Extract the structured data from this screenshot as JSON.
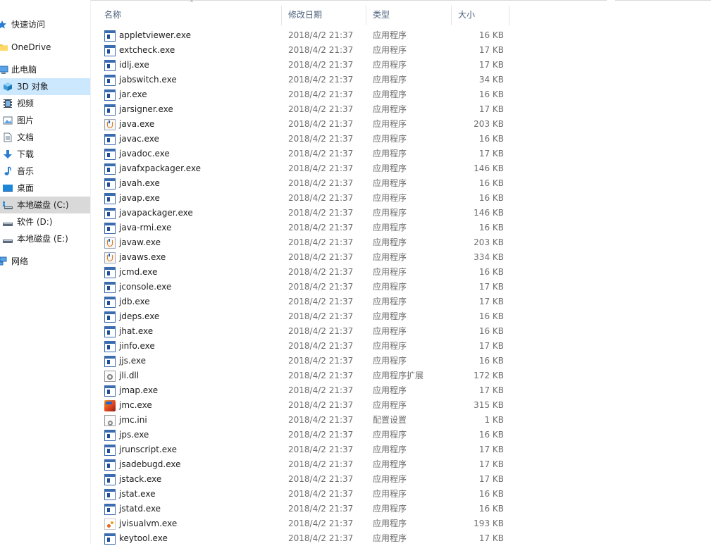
{
  "sidebar": {
    "items": [
      {
        "label": "快速访问",
        "icon": "star-icon"
      },
      {
        "label": "OneDrive",
        "icon": "folder-icon"
      },
      {
        "label": "此电脑",
        "icon": "computer-icon"
      },
      {
        "label": "3D 对象",
        "icon": "cube-3d-icon"
      },
      {
        "label": "视频",
        "icon": "video-icon"
      },
      {
        "label": "图片",
        "icon": "picture-icon"
      },
      {
        "label": "文档",
        "icon": "document-icon"
      },
      {
        "label": "下载",
        "icon": "download-arrow-icon"
      },
      {
        "label": "音乐",
        "icon": "music-note-icon"
      },
      {
        "label": "桌面",
        "icon": "desktop-icon"
      },
      {
        "label": "本地磁盘 (C:)",
        "icon": "system-drive-icon"
      },
      {
        "label": "软件 (D:)",
        "icon": "drive-icon"
      },
      {
        "label": "本地磁盘 (E:)",
        "icon": "drive-icon"
      },
      {
        "label": "网络",
        "icon": "network-icon"
      }
    ]
  },
  "columns": {
    "name": "名称",
    "date": "修改日期",
    "type": "类型",
    "size": "大小"
  },
  "files": [
    {
      "name": "appletviewer.exe",
      "date": "2018/4/2 21:37",
      "type": "应用程序",
      "size": "16 KB",
      "icon": "exe"
    },
    {
      "name": "extcheck.exe",
      "date": "2018/4/2 21:37",
      "type": "应用程序",
      "size": "17 KB",
      "icon": "exe"
    },
    {
      "name": "idlj.exe",
      "date": "2018/4/2 21:37",
      "type": "应用程序",
      "size": "17 KB",
      "icon": "exe"
    },
    {
      "name": "jabswitch.exe",
      "date": "2018/4/2 21:37",
      "type": "应用程序",
      "size": "34 KB",
      "icon": "exe"
    },
    {
      "name": "jar.exe",
      "date": "2018/4/2 21:37",
      "type": "应用程序",
      "size": "16 KB",
      "icon": "exe"
    },
    {
      "name": "jarsigner.exe",
      "date": "2018/4/2 21:37",
      "type": "应用程序",
      "size": "17 KB",
      "icon": "exe"
    },
    {
      "name": "java.exe",
      "date": "2018/4/2 21:37",
      "type": "应用程序",
      "size": "203 KB",
      "icon": "java"
    },
    {
      "name": "javac.exe",
      "date": "2018/4/2 21:37",
      "type": "应用程序",
      "size": "16 KB",
      "icon": "exe"
    },
    {
      "name": "javadoc.exe",
      "date": "2018/4/2 21:37",
      "type": "应用程序",
      "size": "17 KB",
      "icon": "exe"
    },
    {
      "name": "javafxpackager.exe",
      "date": "2018/4/2 21:37",
      "type": "应用程序",
      "size": "146 KB",
      "icon": "exe"
    },
    {
      "name": "javah.exe",
      "date": "2018/4/2 21:37",
      "type": "应用程序",
      "size": "16 KB",
      "icon": "exe"
    },
    {
      "name": "javap.exe",
      "date": "2018/4/2 21:37",
      "type": "应用程序",
      "size": "16 KB",
      "icon": "exe"
    },
    {
      "name": "javapackager.exe",
      "date": "2018/4/2 21:37",
      "type": "应用程序",
      "size": "146 KB",
      "icon": "exe"
    },
    {
      "name": "java-rmi.exe",
      "date": "2018/4/2 21:37",
      "type": "应用程序",
      "size": "16 KB",
      "icon": "exe"
    },
    {
      "name": "javaw.exe",
      "date": "2018/4/2 21:37",
      "type": "应用程序",
      "size": "203 KB",
      "icon": "java"
    },
    {
      "name": "javaws.exe",
      "date": "2018/4/2 21:37",
      "type": "应用程序",
      "size": "334 KB",
      "icon": "java"
    },
    {
      "name": "jcmd.exe",
      "date": "2018/4/2 21:37",
      "type": "应用程序",
      "size": "16 KB",
      "icon": "exe"
    },
    {
      "name": "jconsole.exe",
      "date": "2018/4/2 21:37",
      "type": "应用程序",
      "size": "17 KB",
      "icon": "exe"
    },
    {
      "name": "jdb.exe",
      "date": "2018/4/2 21:37",
      "type": "应用程序",
      "size": "17 KB",
      "icon": "exe"
    },
    {
      "name": "jdeps.exe",
      "date": "2018/4/2 21:37",
      "type": "应用程序",
      "size": "16 KB",
      "icon": "exe"
    },
    {
      "name": "jhat.exe",
      "date": "2018/4/2 21:37",
      "type": "应用程序",
      "size": "16 KB",
      "icon": "exe"
    },
    {
      "name": "jinfo.exe",
      "date": "2018/4/2 21:37",
      "type": "应用程序",
      "size": "17 KB",
      "icon": "exe"
    },
    {
      "name": "jjs.exe",
      "date": "2018/4/2 21:37",
      "type": "应用程序",
      "size": "16 KB",
      "icon": "exe"
    },
    {
      "name": "jli.dll",
      "date": "2018/4/2 21:37",
      "type": "应用程序扩展",
      "size": "172 KB",
      "icon": "dll"
    },
    {
      "name": "jmap.exe",
      "date": "2018/4/2 21:37",
      "type": "应用程序",
      "size": "17 KB",
      "icon": "exe"
    },
    {
      "name": "jmc.exe",
      "date": "2018/4/2 21:37",
      "type": "应用程序",
      "size": "315 KB",
      "icon": "jmc"
    },
    {
      "name": "jmc.ini",
      "date": "2018/4/2 21:37",
      "type": "配置设置",
      "size": "1 KB",
      "icon": "ini"
    },
    {
      "name": "jps.exe",
      "date": "2018/4/2 21:37",
      "type": "应用程序",
      "size": "16 KB",
      "icon": "exe"
    },
    {
      "name": "jrunscript.exe",
      "date": "2018/4/2 21:37",
      "type": "应用程序",
      "size": "17 KB",
      "icon": "exe"
    },
    {
      "name": "jsadebugd.exe",
      "date": "2018/4/2 21:37",
      "type": "应用程序",
      "size": "17 KB",
      "icon": "exe"
    },
    {
      "name": "jstack.exe",
      "date": "2018/4/2 21:37",
      "type": "应用程序",
      "size": "17 KB",
      "icon": "exe"
    },
    {
      "name": "jstat.exe",
      "date": "2018/4/2 21:37",
      "type": "应用程序",
      "size": "16 KB",
      "icon": "exe"
    },
    {
      "name": "jstatd.exe",
      "date": "2018/4/2 21:37",
      "type": "应用程序",
      "size": "16 KB",
      "icon": "exe"
    },
    {
      "name": "jvisualvm.exe",
      "date": "2018/4/2 21:37",
      "type": "应用程序",
      "size": "193 KB",
      "icon": "jvisualvm"
    },
    {
      "name": "keytool.exe",
      "date": "2018/4/2 21:37",
      "type": "应用程序",
      "size": "17 KB",
      "icon": "exe"
    }
  ]
}
